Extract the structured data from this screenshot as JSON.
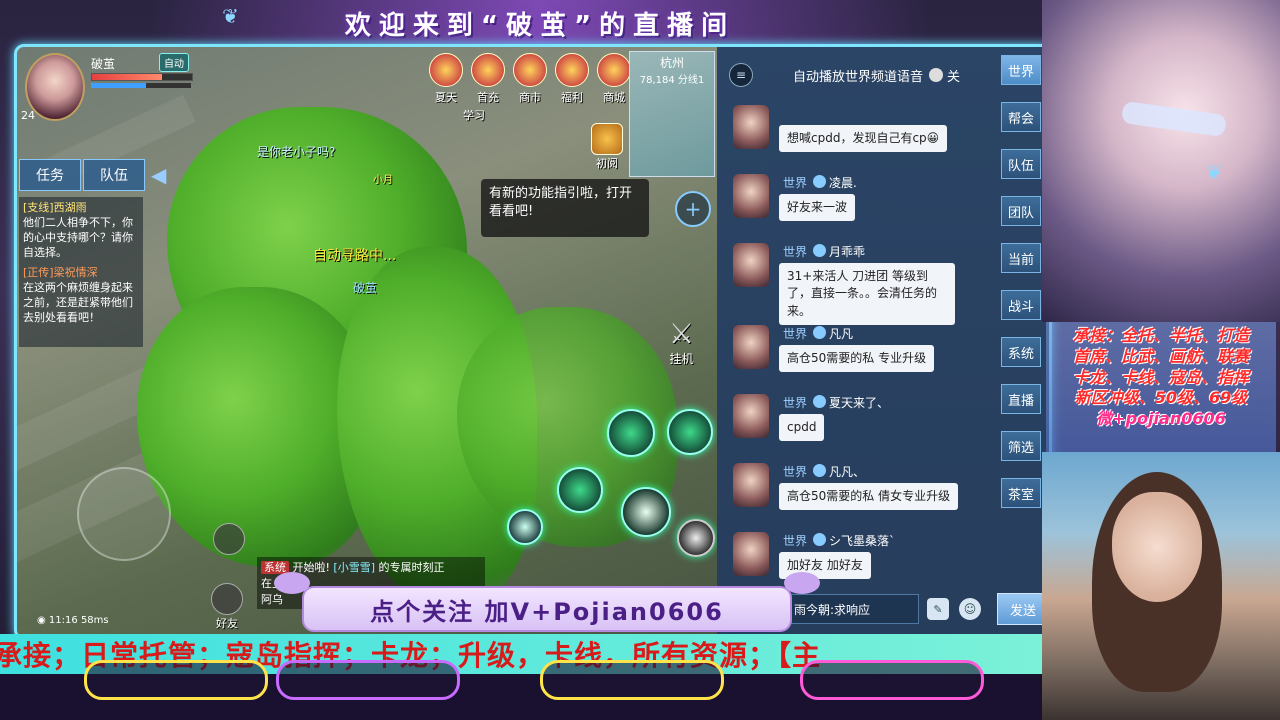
{
  "banner": {
    "welcome": "欢迎来到“破茧”的直播间"
  },
  "player": {
    "name": "破茧",
    "level": "24",
    "auto_label": "自动",
    "hp_percent": 70,
    "mp_percent": 55
  },
  "left_tabs": {
    "quest": "任务",
    "team": "队伍"
  },
  "quests": {
    "q1_title": "[支线]西湖雨",
    "q1_text": "他们二人相争不下，你的心中支持哪个？请你自选择。",
    "q2_title": "[正传]梁祝情深",
    "q2_text": "在这两个麻烦缠身起来之前，还是赶紧带他们去别处看看吧！"
  },
  "top_icons": [
    {
      "label": "夏天"
    },
    {
      "label": "首充"
    },
    {
      "label": "商市"
    },
    {
      "label": "福利"
    },
    {
      "label": "商城"
    }
  ],
  "sub_icons": {
    "first_learn": "初阅",
    "study": "学习"
  },
  "minimap": {
    "city": "杭州",
    "coords": "78,184 分线1"
  },
  "guide_tip": {
    "text": "有新的功能指引啦，打开看看吧!"
  },
  "scene": {
    "auto_path": "自动寻路中...",
    "npc_question": "是你老小子吗?",
    "npc_small": "小月",
    "npc_name": "破茧",
    "hang": "挂机"
  },
  "bottom_left": {
    "friends": "好友",
    "ping": "58ms",
    "time": "11:16"
  },
  "system_chat": {
    "tag": "系统",
    "text1": "开始啦!",
    "who": "[小雪雪]",
    "text2": "的专属时刻正",
    "line2": "在上演",
    "line3": "阿乌"
  },
  "chat": {
    "header_title": "自动播放世界频道语音",
    "header_state": "关",
    "channel_label": "世界",
    "messages": [
      {
        "sender": "",
        "text": "想喊cpdd，发现自己有cp😀"
      },
      {
        "sender": "凌晨.",
        "text": "好友来一波"
      },
      {
        "sender": "月乖乖",
        "text": "31+来活人 刀进团 等级到了，直接一条。。会清任务的来。"
      },
      {
        "sender": "凡凡",
        "text": "高仓50需要的私 专业升级"
      },
      {
        "sender": "夏天来了、",
        "text": "cpdd"
      },
      {
        "sender": "凡凡、",
        "text": "高仓50需要的私 倩女专业升级"
      },
      {
        "sender": "シ飞墨桑落`",
        "text": "加好友 加好友"
      }
    ],
    "tabs": [
      "世界",
      "帮会",
      "队伍",
      "团队",
      "当前",
      "战斗",
      "系统",
      "直播",
      "筛选",
      "茶室"
    ],
    "input_placeholder": "雨今朝:求响应",
    "send": "发送"
  },
  "follow": {
    "text": "点个关注  加V+Pojian0606"
  },
  "ticker": {
    "text": "承接；日常托管；寇岛指挥；卡龙；升级，卡线，所有资源；【主"
  },
  "service": {
    "lines": [
      "承接：全托、半托、打造",
      "首席、比武、画舫、联赛",
      "卡龙、卡线、寇岛、指挥",
      "新区冲级、50级、69级"
    ],
    "wechat": "微+pojian0606"
  },
  "colors": {
    "frame": "#7fe6ff",
    "ticker_bg": "#3ee0e0",
    "ticker_text": "#d81a1a",
    "accent": "#4a1f86"
  },
  "icons": {
    "menu": "list-icon",
    "emoji": "emoji-icon",
    "voice": "voice-icon",
    "add": "plus-icon",
    "hang": "crossed-swords-icon"
  }
}
